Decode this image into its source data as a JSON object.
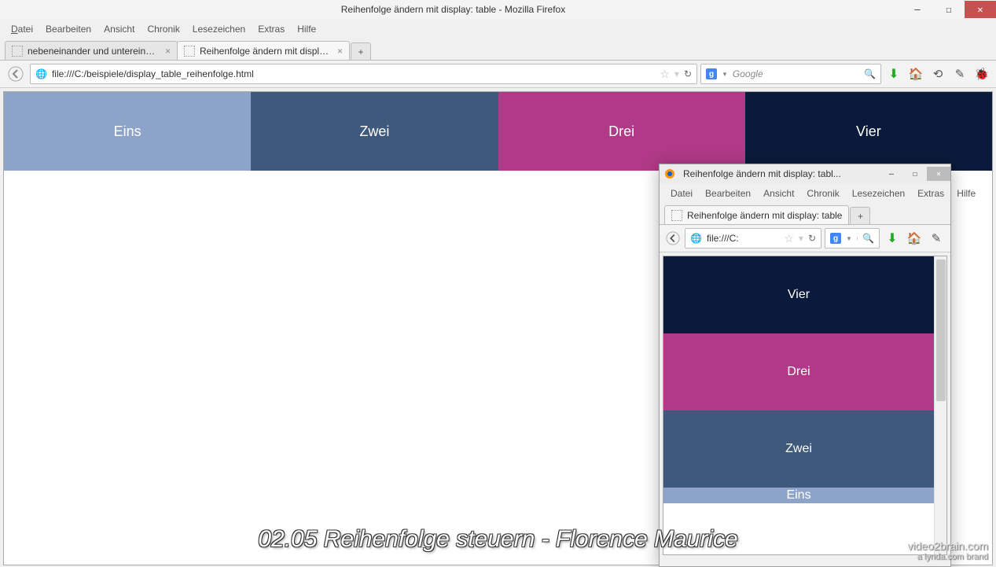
{
  "mainWindow": {
    "title": "Reihenfolge ändern mit display: table - Mozilla Firefox",
    "menu": {
      "datei": "Datei",
      "bearbeiten": "Bearbeiten",
      "ansicht": "Ansicht",
      "chronik": "Chronik",
      "lesezeichen": "Lesezeichen",
      "extras": "Extras",
      "hilfe": "Hilfe"
    },
    "tabs": [
      {
        "label": "nebeneinander und untereinander un...",
        "active": false
      },
      {
        "label": "Reihenfolge ändern mit display: table",
        "active": true
      }
    ],
    "url": "file:///C:/beispiele/display_table_reihenfolge.html",
    "search_placeholder": "Google",
    "boxes": [
      {
        "label": "Eins",
        "color": "#8ea3c8"
      },
      {
        "label": "Zwei",
        "color": "#3e597b"
      },
      {
        "label": "Drei",
        "color": "#b03a87"
      },
      {
        "label": "Vier",
        "color": "#0b1a3a"
      }
    ]
  },
  "smallWindow": {
    "title": "Reihenfolge ändern mit display: tabl...",
    "menu": {
      "datei": "Datei",
      "bearbeiten": "Bearbeiten",
      "ansicht": "Ansicht",
      "chronik": "Chronik",
      "lesezeichen": "Lesezeichen",
      "extras": "Extras",
      "hilfe": "Hilfe"
    },
    "tabs": [
      {
        "label": "Reihenfolge ändern mit display: table",
        "active": true
      }
    ],
    "url": "file:///C:",
    "search_placeholder": "Go",
    "boxes": [
      {
        "label": "Vier",
        "color": "#0b1a3a"
      },
      {
        "label": "Drei",
        "color": "#b03a87"
      },
      {
        "label": "Zwei",
        "color": "#3e597b"
      },
      {
        "label": "Eins",
        "color": "#8ea3c8"
      }
    ]
  },
  "caption": "02.05 Reihenfolge steuern - Florence Maurice",
  "brand": {
    "line1": "video2brain.com",
    "line2": "a lynda.com brand"
  }
}
